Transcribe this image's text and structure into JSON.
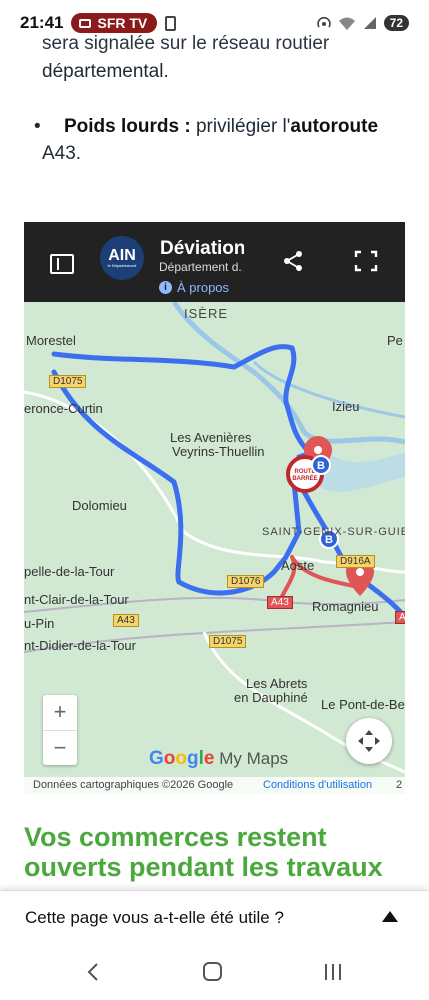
{
  "status_bar": {
    "time": "21:41",
    "carrier_badge": "SFR TV",
    "battery": "72",
    "icons": [
      "tv-icon",
      "phone-icon",
      "hotspot-icon",
      "wifi-icon",
      "signal-icon",
      "battery-icon"
    ]
  },
  "article": {
    "partial_line": "sera signalée sur le réseau routier",
    "line_2": "départemental.",
    "bullet_label": "Poids lourds :",
    "bullet_text_1": " privilégier l'",
    "bullet_bold": "autoroute",
    "bullet_text_2": "A43."
  },
  "map": {
    "logo_text": "AIN",
    "logo_sub": "le Département",
    "title": "Déviation...",
    "subtitle": "Département d...",
    "about_label": "À propos",
    "places": {
      "morestel": "Morestel",
      "isere": "ISÈRE",
      "pe": "Pe",
      "izieu": "Izieu",
      "creys": "eronce-Curtin",
      "avenieres": "Les Avenières",
      "veyrins": "Veyrins-Thuellin",
      "dolomieu": "Dolomieu",
      "st_genix": "SAINT-GENIX-SUR-GUIERS",
      "aoste": "Aoste",
      "romagnieu": "Romagnieu",
      "chapelle": "pelle-de-la-Tour",
      "st_clair": "nt-Clair-de-la-Tour",
      "pin": "u-Pin",
      "st_didier": "nt-Didier-de-la-Tour",
      "abrets_1": "Les Abrets",
      "abrets_2": "en Dauphiné",
      "pont": "Le Pont-de-Be"
    },
    "roads": {
      "d1075_top": "D1075",
      "d1076": "D1076",
      "d916a": "D916A",
      "a43_mid": "A43",
      "a43_left": "A43",
      "d1075_bot": "D1075",
      "a43_right": "A4"
    },
    "barrier_label": "ROUTE BARRÉE",
    "marker_b": "B",
    "zoom_in": "+",
    "zoom_out": "−",
    "google_g": "G",
    "google_o1": "o",
    "google_o2": "o",
    "google_g2": "g",
    "google_l": "l",
    "google_e": "e",
    "google_mymaps": " My Maps",
    "footer_attribution": "Données cartographiques ©2026 Google",
    "footer_link": "Conditions d'utilisation",
    "footer_num": "2",
    "colors": {
      "route_blue": "#3b6ff0",
      "route_red": "#e05555",
      "header": "#222222"
    }
  },
  "promo": {
    "line1": "Vos commerces restent",
    "line2": "ouverts pendant les travaux"
  },
  "feedback": {
    "label": "Cette page vous a-t-elle été utile ?"
  }
}
